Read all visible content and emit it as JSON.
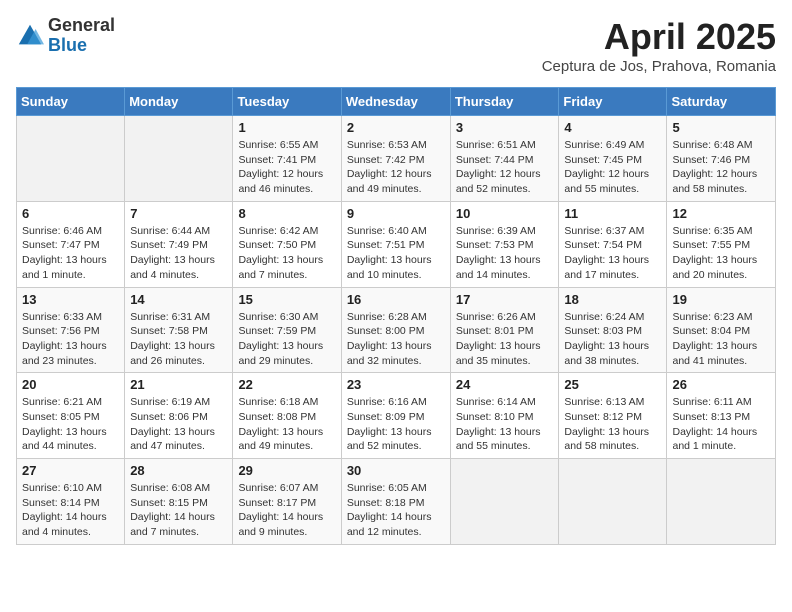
{
  "header": {
    "logo_general": "General",
    "logo_blue": "Blue",
    "month_title": "April 2025",
    "location": "Ceptura de Jos, Prahova, Romania"
  },
  "weekdays": [
    "Sunday",
    "Monday",
    "Tuesday",
    "Wednesday",
    "Thursday",
    "Friday",
    "Saturday"
  ],
  "weeks": [
    [
      {
        "day": "",
        "info": ""
      },
      {
        "day": "",
        "info": ""
      },
      {
        "day": "1",
        "info": "Sunrise: 6:55 AM\nSunset: 7:41 PM\nDaylight: 12 hours and 46 minutes."
      },
      {
        "day": "2",
        "info": "Sunrise: 6:53 AM\nSunset: 7:42 PM\nDaylight: 12 hours and 49 minutes."
      },
      {
        "day": "3",
        "info": "Sunrise: 6:51 AM\nSunset: 7:44 PM\nDaylight: 12 hours and 52 minutes."
      },
      {
        "day": "4",
        "info": "Sunrise: 6:49 AM\nSunset: 7:45 PM\nDaylight: 12 hours and 55 minutes."
      },
      {
        "day": "5",
        "info": "Sunrise: 6:48 AM\nSunset: 7:46 PM\nDaylight: 12 hours and 58 minutes."
      }
    ],
    [
      {
        "day": "6",
        "info": "Sunrise: 6:46 AM\nSunset: 7:47 PM\nDaylight: 13 hours and 1 minute."
      },
      {
        "day": "7",
        "info": "Sunrise: 6:44 AM\nSunset: 7:49 PM\nDaylight: 13 hours and 4 minutes."
      },
      {
        "day": "8",
        "info": "Sunrise: 6:42 AM\nSunset: 7:50 PM\nDaylight: 13 hours and 7 minutes."
      },
      {
        "day": "9",
        "info": "Sunrise: 6:40 AM\nSunset: 7:51 PM\nDaylight: 13 hours and 10 minutes."
      },
      {
        "day": "10",
        "info": "Sunrise: 6:39 AM\nSunset: 7:53 PM\nDaylight: 13 hours and 14 minutes."
      },
      {
        "day": "11",
        "info": "Sunrise: 6:37 AM\nSunset: 7:54 PM\nDaylight: 13 hours and 17 minutes."
      },
      {
        "day": "12",
        "info": "Sunrise: 6:35 AM\nSunset: 7:55 PM\nDaylight: 13 hours and 20 minutes."
      }
    ],
    [
      {
        "day": "13",
        "info": "Sunrise: 6:33 AM\nSunset: 7:56 PM\nDaylight: 13 hours and 23 minutes."
      },
      {
        "day": "14",
        "info": "Sunrise: 6:31 AM\nSunset: 7:58 PM\nDaylight: 13 hours and 26 minutes."
      },
      {
        "day": "15",
        "info": "Sunrise: 6:30 AM\nSunset: 7:59 PM\nDaylight: 13 hours and 29 minutes."
      },
      {
        "day": "16",
        "info": "Sunrise: 6:28 AM\nSunset: 8:00 PM\nDaylight: 13 hours and 32 minutes."
      },
      {
        "day": "17",
        "info": "Sunrise: 6:26 AM\nSunset: 8:01 PM\nDaylight: 13 hours and 35 minutes."
      },
      {
        "day": "18",
        "info": "Sunrise: 6:24 AM\nSunset: 8:03 PM\nDaylight: 13 hours and 38 minutes."
      },
      {
        "day": "19",
        "info": "Sunrise: 6:23 AM\nSunset: 8:04 PM\nDaylight: 13 hours and 41 minutes."
      }
    ],
    [
      {
        "day": "20",
        "info": "Sunrise: 6:21 AM\nSunset: 8:05 PM\nDaylight: 13 hours and 44 minutes."
      },
      {
        "day": "21",
        "info": "Sunrise: 6:19 AM\nSunset: 8:06 PM\nDaylight: 13 hours and 47 minutes."
      },
      {
        "day": "22",
        "info": "Sunrise: 6:18 AM\nSunset: 8:08 PM\nDaylight: 13 hours and 49 minutes."
      },
      {
        "day": "23",
        "info": "Sunrise: 6:16 AM\nSunset: 8:09 PM\nDaylight: 13 hours and 52 minutes."
      },
      {
        "day": "24",
        "info": "Sunrise: 6:14 AM\nSunset: 8:10 PM\nDaylight: 13 hours and 55 minutes."
      },
      {
        "day": "25",
        "info": "Sunrise: 6:13 AM\nSunset: 8:12 PM\nDaylight: 13 hours and 58 minutes."
      },
      {
        "day": "26",
        "info": "Sunrise: 6:11 AM\nSunset: 8:13 PM\nDaylight: 14 hours and 1 minute."
      }
    ],
    [
      {
        "day": "27",
        "info": "Sunrise: 6:10 AM\nSunset: 8:14 PM\nDaylight: 14 hours and 4 minutes."
      },
      {
        "day": "28",
        "info": "Sunrise: 6:08 AM\nSunset: 8:15 PM\nDaylight: 14 hours and 7 minutes."
      },
      {
        "day": "29",
        "info": "Sunrise: 6:07 AM\nSunset: 8:17 PM\nDaylight: 14 hours and 9 minutes."
      },
      {
        "day": "30",
        "info": "Sunrise: 6:05 AM\nSunset: 8:18 PM\nDaylight: 14 hours and 12 minutes."
      },
      {
        "day": "",
        "info": ""
      },
      {
        "day": "",
        "info": ""
      },
      {
        "day": "",
        "info": ""
      }
    ]
  ]
}
